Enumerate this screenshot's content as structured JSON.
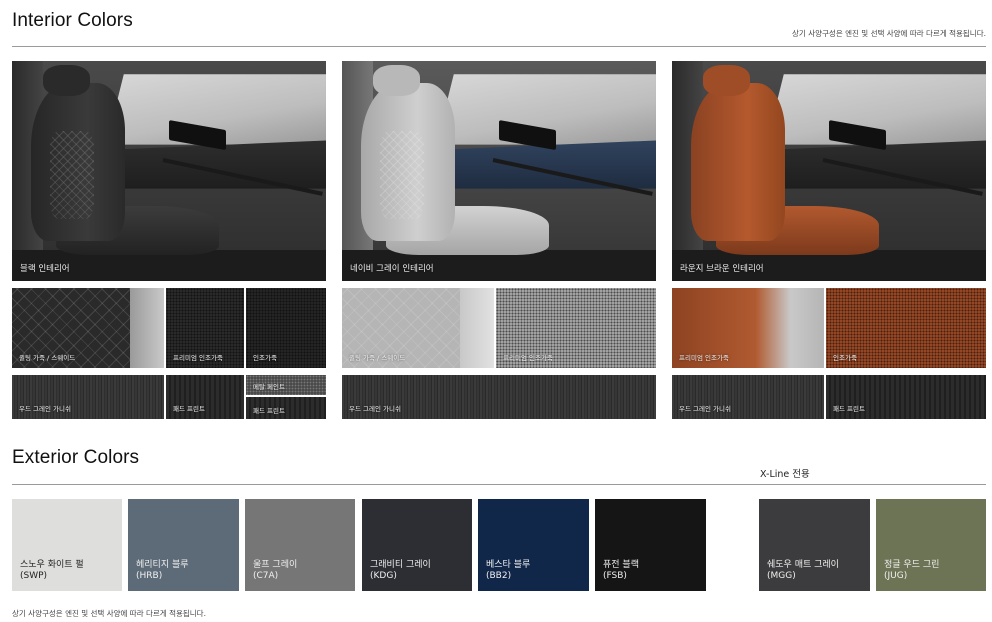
{
  "interior": {
    "title": "Interior Colors",
    "note": "상기 사양구성은 엔진 및 선택 사양에 따라 다르게 적용됩니다.",
    "packages": [
      {
        "photo_label": "블랙 인테리어",
        "seat_color": "#2e2e2e",
        "dash_color": "#2a2a2a",
        "cabin_color": "#3a3a3a",
        "swatches_row1": [
          "퀼팅 가죽 / 스웨이드",
          "프리미엄 인조가죽",
          "인조가죽"
        ],
        "swatches_row2": [
          "우드 그레인 가니쉬",
          "패드 프린트",
          "메탈 페인트",
          "패드 프린트"
        ]
      },
      {
        "photo_label": "네이비 그레이 인테리어",
        "seat_color": "#bdbdbd",
        "dash_color": "#2c3e58",
        "cabin_color": "#4a4a4a",
        "swatches_row1": [
          "퀼팅 가죽 / 스웨이드",
          "프리미엄 인조가죽"
        ],
        "swatches_row2": [
          "우드 그레인 가니쉬"
        ]
      },
      {
        "photo_label": "라운지 브라운 인테리어",
        "seat_color": "#a24f2a",
        "dash_color": "#2a2a2a",
        "cabin_color": "#3a3a3a",
        "swatches_row1": [
          "프리미엄 인조가죽",
          "인조가죽"
        ],
        "swatches_row2": [
          "우드 그레인 가니쉬",
          "패드 프린트"
        ]
      }
    ]
  },
  "exterior": {
    "title": "Exterior Colors",
    "xline_label": "X-Line 전용",
    "colors": [
      {
        "name": "스노우 화이트 펄",
        "code": "(SWP)",
        "hex": "#dededc"
      },
      {
        "name": "헤리티지 블루",
        "code": "(HRB)",
        "hex": "#5d6b78"
      },
      {
        "name": "울프 그레이",
        "code": "(C7A)",
        "hex": "#767676"
      },
      {
        "name": "그래비티 그레이",
        "code": "(KDG)",
        "hex": "#2c2e33"
      },
      {
        "name": "베스타 블루",
        "code": "(BB2)",
        "hex": "#10274a"
      },
      {
        "name": "퓨전 블랙",
        "code": "(FSB)",
        "hex": "#151515"
      },
      {
        "name": "쉐도우 매트 그레이",
        "code": "(MGG)",
        "hex": "#3c3c3e"
      },
      {
        "name": "정글 우드 그린",
        "code": "(JUG)",
        "hex": "#6d7455"
      }
    ],
    "note": "상기 사양구성은 엔진 및 선택 사양에 따라 다르게 적용됩니다."
  }
}
